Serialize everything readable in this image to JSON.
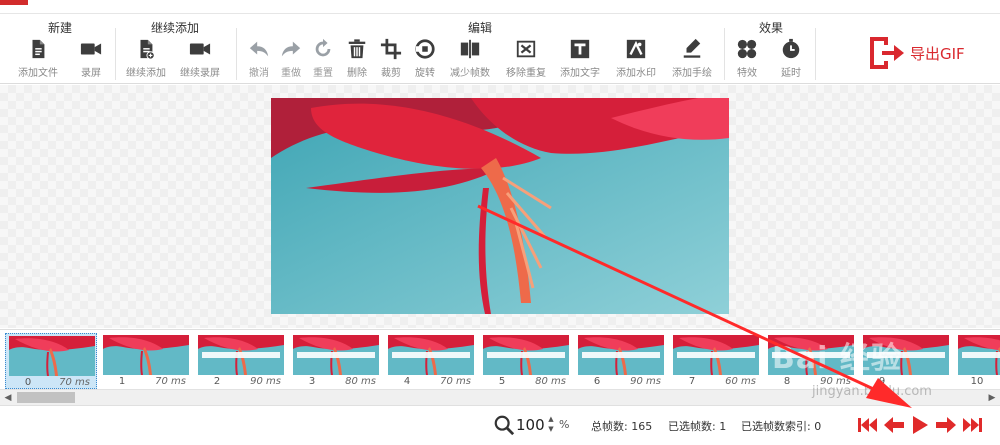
{
  "ribbon": {
    "groups": [
      {
        "title": "新建",
        "tools": [
          {
            "label": "添加文件",
            "icon": "add-file-icon"
          },
          {
            "label": "录屏",
            "icon": "video-camera-icon"
          }
        ]
      },
      {
        "title": "继续添加",
        "tools": [
          {
            "label": "继续添加",
            "icon": "continue-add-icon"
          },
          {
            "label": "继续录屏",
            "icon": "continue-record-icon"
          }
        ]
      },
      {
        "title": "编辑",
        "tools": [
          {
            "label": "撤消",
            "icon": "undo-icon"
          },
          {
            "label": "重做",
            "icon": "redo-icon"
          },
          {
            "label": "重置",
            "icon": "reset-icon"
          },
          {
            "label": "删除",
            "icon": "trash-icon"
          },
          {
            "label": "裁剪",
            "icon": "crop-icon"
          },
          {
            "label": "旋转",
            "icon": "rotate-icon"
          },
          {
            "label": "减少帧数",
            "icon": "reduce-frames-icon"
          },
          {
            "label": "移除重复",
            "icon": "remove-duplicates-icon"
          },
          {
            "label": "添加文字",
            "icon": "add-text-icon"
          },
          {
            "label": "添加水印",
            "icon": "watermark-icon"
          },
          {
            "label": "添加手绘",
            "icon": "freehand-icon"
          }
        ]
      },
      {
        "title": "效果",
        "tools": [
          {
            "label": "特效",
            "icon": "effects-icon"
          },
          {
            "label": "延时",
            "icon": "delay-icon"
          }
        ]
      }
    ],
    "export": {
      "label": "导出GIF",
      "icon": "export-icon"
    }
  },
  "filmstrip": {
    "frames": [
      {
        "index": "0",
        "duration": "70 ms",
        "selected": true
      },
      {
        "index": "1",
        "duration": "70 ms",
        "selected": false
      },
      {
        "index": "2",
        "duration": "90 ms",
        "selected": false
      },
      {
        "index": "3",
        "duration": "80 ms",
        "selected": false
      },
      {
        "index": "4",
        "duration": "70 ms",
        "selected": false
      },
      {
        "index": "5",
        "duration": "80 ms",
        "selected": false
      },
      {
        "index": "6",
        "duration": "90 ms",
        "selected": false
      },
      {
        "index": "7",
        "duration": "60 ms",
        "selected": false
      },
      {
        "index": "8",
        "duration": "90 ms",
        "selected": false
      },
      {
        "index": "9",
        "duration": "",
        "selected": false
      },
      {
        "index": "10",
        "duration": "",
        "selected": false
      }
    ]
  },
  "status": {
    "zoom_value": "100",
    "zoom_unit": "%",
    "total_frames": "总帧数:  165",
    "selected_frames": "已选帧数:  1",
    "selected_index": "已选帧数索引:  0"
  },
  "watermark": {
    "text": "Bai 经验",
    "sub": "jingyan.baidu.com"
  },
  "colors": {
    "accent": "#d9282e",
    "icon": "#3d3d3d",
    "selection": "#cce6f7",
    "annotation": "#ff2a2a",
    "sky": "#6fc0cc",
    "petal": "#e0243c"
  }
}
